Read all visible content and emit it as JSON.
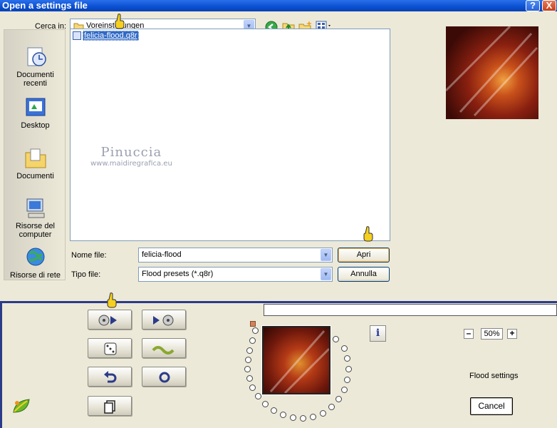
{
  "dialog": {
    "title": "Open a settings file",
    "help_glyph": "?",
    "close_glyph": "X",
    "look_in_label": "Cerca in:",
    "look_in_value": "Voreinstellungen",
    "places": [
      {
        "label": "Documenti recenti",
        "icon": "recent-documents-icon"
      },
      {
        "label": "Desktop",
        "icon": "desktop-icon"
      },
      {
        "label": "Documenti",
        "icon": "documents-folder-icon"
      },
      {
        "label": "Risorse del computer",
        "icon": "my-computer-icon"
      },
      {
        "label": "Risorse di rete",
        "icon": "network-icon"
      }
    ],
    "files": [
      {
        "name": "felicia-flood.q8r",
        "icon": "q8r-file-icon",
        "selected": true
      }
    ],
    "filename_label": "Nome file:",
    "filename_value": "felicia-flood",
    "filetype_label": "Tipo file:",
    "filetype_value": "Flood presets (*.q8r)",
    "open_button": "Apri",
    "cancel_button": "Annulla"
  },
  "watermark": {
    "line1": "Pinuccia",
    "line2": "www.maidiregrafica.eu"
  },
  "filter_panel": {
    "zoom_minus": "–",
    "zoom_value": "50%",
    "zoom_plus": "+",
    "info_glyph": "i",
    "settings_label": "Flood settings",
    "cancel_label": "Cancel"
  },
  "colors": {
    "title_bar": "#0a4fd1",
    "selection": "#316ac5",
    "panel_border": "#2b3b8a",
    "face": "#ece9d8"
  }
}
